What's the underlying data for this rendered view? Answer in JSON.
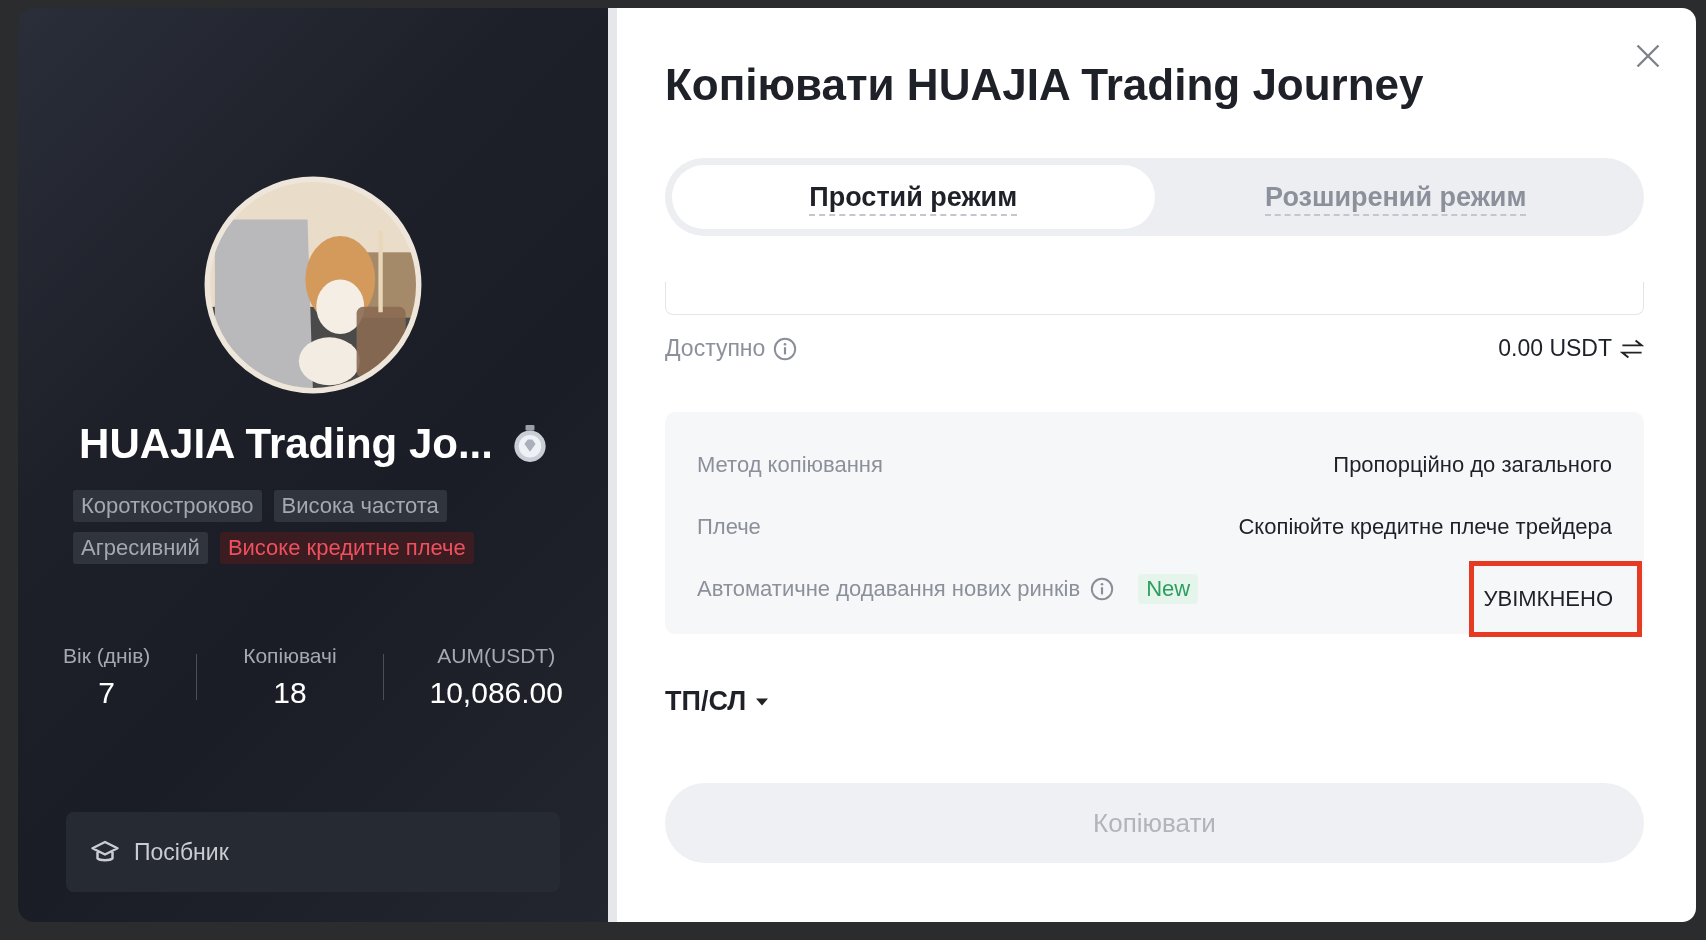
{
  "trader": {
    "name": "HUAJIA Trading Jo...",
    "tags": [
      {
        "label": "Короткостроково",
        "kind": "neutral"
      },
      {
        "label": "Висока частота",
        "kind": "neutral"
      },
      {
        "label": "Агресивний",
        "kind": "neutral"
      },
      {
        "label": "Високе кредитне плече",
        "kind": "warning"
      }
    ],
    "stats": [
      {
        "label": "Вік (днів)",
        "value": "7"
      },
      {
        "label": "Копіювачі",
        "value": "18"
      },
      {
        "label": "AUM(USDT)",
        "value": "10,086.00"
      }
    ],
    "guide_button": "Посібник"
  },
  "dialog": {
    "title": "Копіювати HUAJIA Trading Journey",
    "tabs": [
      {
        "label": "Простий режим",
        "selected": true
      },
      {
        "label": "Розширений режим",
        "selected": false
      }
    ],
    "available": {
      "label": "Доступно",
      "value": "0.00 USDT"
    },
    "settings": [
      {
        "label": "Метод копіювання",
        "value": "Пропорційно до загального",
        "highlighted": false
      },
      {
        "label": "Плече",
        "value": "Скопіюйте кредитне плече трейдера",
        "highlighted": false
      },
      {
        "label": "Автоматичне додавання нових ринків",
        "badge": "New",
        "value": "УВІМКНЕНО",
        "highlighted": true
      }
    ],
    "tp_sl": {
      "label": "ТП/СЛ",
      "expanded": false
    },
    "copy_button": {
      "label": "Копіювати",
      "disabled": true
    }
  }
}
